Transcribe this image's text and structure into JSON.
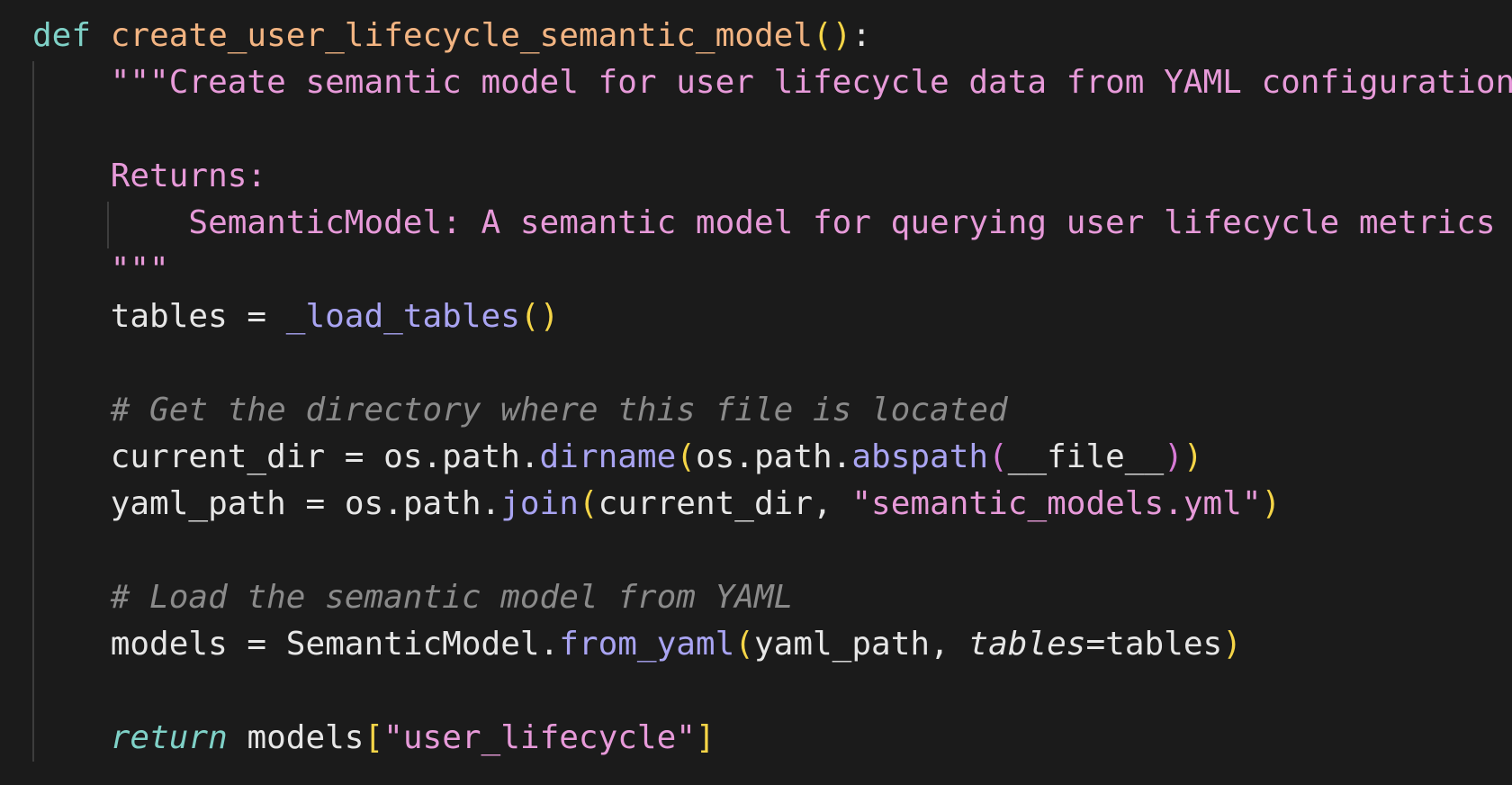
{
  "code": {
    "kw_def": "def",
    "fn_name": "create_user_lifecycle_semantic_model",
    "open_paren": "(",
    "close_paren": ")",
    "colon": ":",
    "doc_line1": "\"\"\"Create semantic model for user lifecycle data from YAML configuration.",
    "doc_returns": "Returns:",
    "doc_return_desc": "SemanticModel: A semantic model for querying user lifecycle metrics",
    "doc_close": "\"\"\"",
    "tables_var": "tables",
    "assign": " = ",
    "load_tables_fn": "_load_tables",
    "comment1": "# Get the directory where this file is located",
    "current_dir_var": "current_dir",
    "os_path": "os.path.",
    "dirname_fn": "dirname",
    "abspath_fn": "abspath",
    "file_var": "__file__",
    "yaml_path_var": "yaml_path",
    "join_fn": "join",
    "comma_space": ", ",
    "yaml_filename": "\"semantic_models.yml\"",
    "comment2": "# Load the semantic model from YAML",
    "models_var": "models",
    "semantic_model_cls": "SemanticModel.",
    "from_yaml_fn": "from_yaml",
    "tables_kw": "tables",
    "equals": "=",
    "kw_return": "return",
    "open_bracket": "[",
    "close_bracket": "]",
    "lifecycle_key": "\"user_lifecycle\""
  },
  "colors": {
    "background": "#1b1b1b",
    "keyword": "#7fd1c7",
    "function_def": "#f2b482",
    "function_call": "#a9a4f2",
    "string": "#e79ad9",
    "comment": "#8a8a8a",
    "bracket_outer": "#f5d547",
    "bracket_inner": "#d77ad6"
  }
}
